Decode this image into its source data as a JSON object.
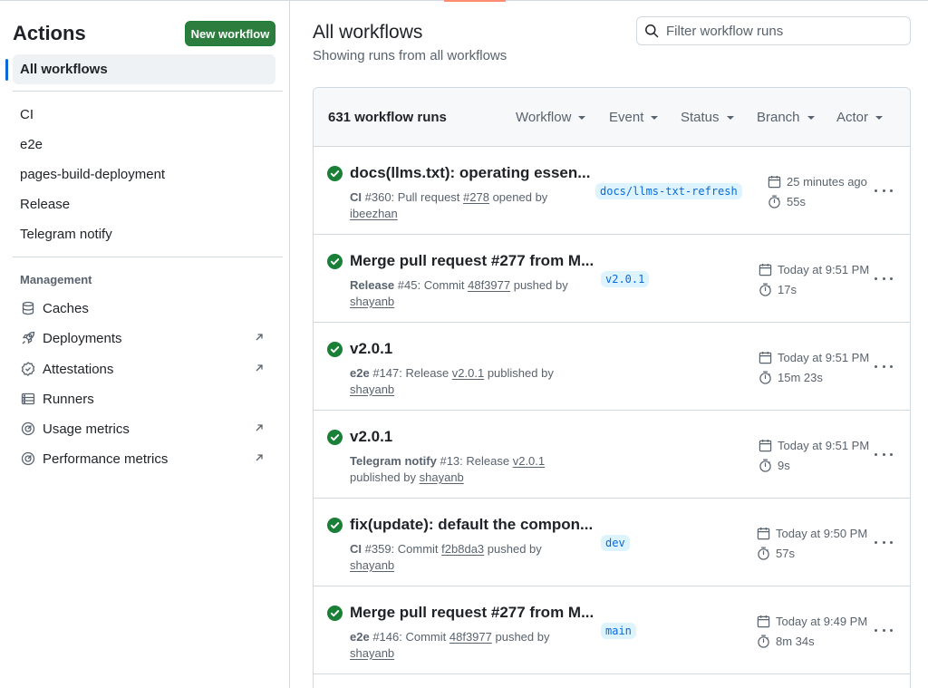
{
  "sidebar": {
    "title": "Actions",
    "new_workflow_label": "New workflow",
    "active_item": "All workflows",
    "workflows": [
      "CI",
      "e2e",
      "pages-build-deployment",
      "Release",
      "Telegram notify"
    ],
    "management_label": "Management",
    "management": [
      {
        "label": "Caches",
        "icon": "database-icon",
        "external": false
      },
      {
        "label": "Deployments",
        "icon": "rocket-icon",
        "external": true
      },
      {
        "label": "Attestations",
        "icon": "verified-icon",
        "external": true
      },
      {
        "label": "Runners",
        "icon": "server-icon",
        "external": false
      },
      {
        "label": "Usage metrics",
        "icon": "meter-icon",
        "external": true
      },
      {
        "label": "Performance metrics",
        "icon": "meter-icon",
        "external": true
      }
    ]
  },
  "main": {
    "title": "All workflows",
    "subtitle": "Showing runs from all workflows",
    "filter_placeholder": "Filter workflow runs",
    "runs_count": "631 workflow runs",
    "filters": [
      "Workflow",
      "Event",
      "Status",
      "Branch",
      "Actor"
    ]
  },
  "runs": [
    {
      "title": "docs(llms.txt): operating essen...",
      "workflow": "CI",
      "number": "#360",
      "trigger": ": Pull request ",
      "ref": "#278",
      "action": " opened by",
      "actor": "ibeezhan",
      "branch": "docs/llms-txt-refresh",
      "time": "25 minutes ago",
      "duration": "55s",
      "status": "success"
    },
    {
      "title": "Merge pull request #277 from M...",
      "workflow": "Release",
      "number": "#45",
      "trigger": ": Commit ",
      "ref": "48f3977",
      "action": " pushed by",
      "actor": "shayanb",
      "branch": "v2.0.1",
      "time": "Today at 9:51 PM",
      "duration": "17s",
      "status": "success"
    },
    {
      "title": "v2.0.1",
      "workflow": "e2e",
      "number": "#147",
      "trigger": ": Release ",
      "ref": "v2.0.1",
      "action": " published by",
      "actor": "shayanb",
      "branch": "",
      "time": "Today at 9:51 PM",
      "duration": "15m 23s",
      "status": "success"
    },
    {
      "title": "v2.0.1",
      "workflow": "Telegram notify",
      "number": "#13",
      "trigger": ": Release ",
      "ref": "v2.0.1",
      "action": " published by",
      "actor": "shayanb",
      "branch": "",
      "time": "Today at 9:51 PM",
      "duration": "9s",
      "status": "success"
    },
    {
      "title": "fix(update): default the compon...",
      "workflow": "CI",
      "number": "#359",
      "trigger": ": Commit ",
      "ref": "f2b8da3",
      "action": " pushed by",
      "actor": "shayanb",
      "branch": "dev",
      "time": "Today at 9:50 PM",
      "duration": "57s",
      "status": "success"
    },
    {
      "title": "Merge pull request #277 from M...",
      "workflow": "e2e",
      "number": "#146",
      "trigger": ": Commit ",
      "ref": "48f3977",
      "action": " pushed by",
      "actor": "shayanb",
      "branch": "main",
      "time": "Today at 9:49 PM",
      "duration": "8m 34s",
      "status": "success"
    }
  ],
  "colors": {
    "success": "#1a7f37",
    "button": "#2d7d3e",
    "accent": "#0969da",
    "tab_underline": "#fd8c73"
  }
}
